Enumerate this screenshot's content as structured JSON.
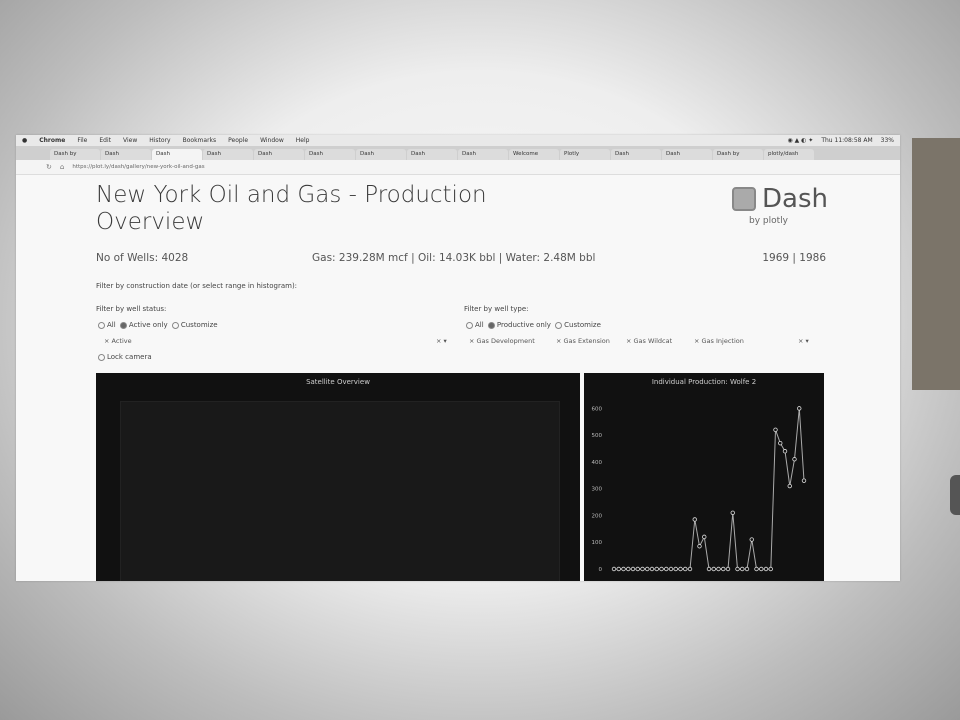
{
  "menubar": {
    "app": "Chrome",
    "items": [
      "File",
      "Edit",
      "View",
      "History",
      "Bookmarks",
      "People",
      "Window",
      "Help"
    ],
    "clock": "Thu 11:08:58 AM",
    "battery": "33%"
  },
  "tabs": [
    "Dash by",
    "Dash",
    "Dash",
    "Dash",
    "Dash",
    "Dash",
    "Dash",
    "Dash",
    "Dash",
    "Welcome",
    "Plotly",
    "Dash",
    "Dash",
    "Dash by",
    "plotly/dash"
  ],
  "urlbar": {
    "url": "https://plot.ly/dash/gallery/new-york-oil-and-gas"
  },
  "header": {
    "title": "New York Oil and Gas - Production Overview",
    "logo_text": "Dash",
    "logo_sub": "by plotly"
  },
  "stats": {
    "wells": "No of Wells: 4028",
    "production": "Gas: 239.28M mcf | Oil: 14.03K bbl | Water: 2.48M bbl",
    "years": "1969 | 1986"
  },
  "filters": {
    "construction_label": "Filter by construction date (or select range in histogram):",
    "status_label": "Filter by well status:",
    "status_options": [
      "All",
      "Active only",
      "Customize"
    ],
    "status_selected": "Active only",
    "status_chip": "Active",
    "type_label": "Filter by well type:",
    "type_options": [
      "All",
      "Productive only",
      "Customize"
    ],
    "type_selected": "Productive only",
    "type_chips": [
      "Gas Development",
      "Gas Extension",
      "Gas Wildcat",
      "Gas Injection"
    ],
    "lock_camera": "Lock camera"
  },
  "panels": {
    "map_title": "Satellite Overview",
    "prod_title": "Individual Production: Wolfe 2"
  },
  "colors": {
    "panel_bg": "#111111",
    "line": "#aaaaaa"
  },
  "chart_data": {
    "type": "line",
    "title": "Individual Production: Wolfe 2",
    "ylim": [
      0,
      650
    ],
    "yticks": [
      0,
      100,
      200,
      300,
      400,
      500,
      600
    ],
    "series": [
      {
        "values": [
          0,
          0,
          0,
          0,
          0,
          0,
          0,
          0,
          0,
          0,
          0,
          0,
          0,
          0,
          0,
          0,
          0,
          185,
          85,
          120,
          0,
          0,
          0,
          0,
          0,
          210,
          0,
          0,
          0,
          110,
          0,
          0,
          0,
          0,
          520,
          470,
          440,
          310,
          410,
          600,
          330
        ]
      }
    ]
  }
}
